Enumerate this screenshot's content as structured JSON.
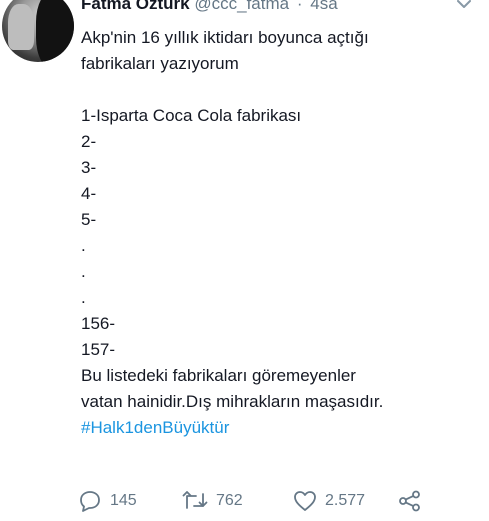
{
  "tweet": {
    "author_name": "Fatma Öztürk",
    "author_handle": "@ccc_fatma",
    "separator": "·",
    "time": "4sa",
    "lines": [
      "Akp'nin 16 yıllık iktidarı boyunca açtığı",
      "fabrikaları yazıyorum",
      "",
      "1-Isparta Coca Cola fabrikası",
      "2-",
      "3-",
      "4-",
      "5-",
      ".",
      ".",
      ".",
      "156-",
      "157-",
      "Bu listedeki fabrikaları göremeyenler",
      "vatan hainidir.Dış mihrakların maşasıdır."
    ],
    "hashtag": "#Halk1denBüyüktür"
  },
  "actions": {
    "reply_count": "145",
    "retweet_count": "762",
    "like_count": "2.577"
  },
  "icons": {
    "menu": "chevron-down-icon",
    "reply": "reply-icon",
    "retweet": "retweet-icon",
    "like": "heart-icon",
    "share": "share-icon"
  },
  "colors": {
    "text": "#141823",
    "secondary": "#657786",
    "link": "#1b95e0"
  }
}
